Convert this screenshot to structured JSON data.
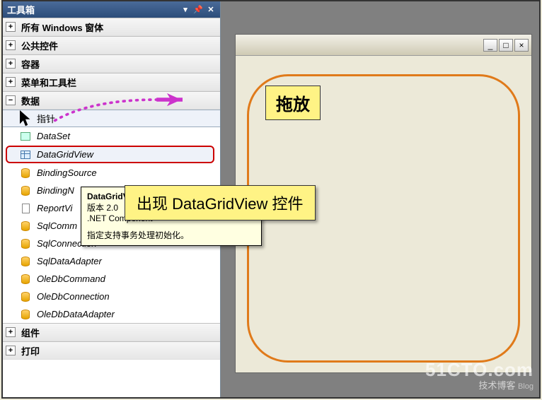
{
  "toolbox": {
    "title": "工具箱",
    "categories": [
      {
        "label": "所有 Windows 窗体",
        "expanded": false
      },
      {
        "label": "公共控件",
        "expanded": false
      },
      {
        "label": "容器",
        "expanded": false
      },
      {
        "label": "菜单和工具栏",
        "expanded": false
      },
      {
        "label": "数据",
        "expanded": true
      },
      {
        "label": "组件",
        "expanded": false
      },
      {
        "label": "打印",
        "expanded": false
      }
    ],
    "data_items": [
      {
        "label": "指针",
        "icon": "cursor",
        "pointer": true,
        "highlight": true
      },
      {
        "label": "DataSet",
        "icon": "box"
      },
      {
        "label": "DataGridView",
        "icon": "grid",
        "selected": true
      },
      {
        "label": "BindingSource",
        "icon": "cyl"
      },
      {
        "label": "BindingNavigator",
        "icon": "cyl",
        "truncated": "BindingN"
      },
      {
        "label": "ReportViewer",
        "icon": "doc",
        "truncated": "ReportVi"
      },
      {
        "label": "SqlCommand",
        "icon": "cyl",
        "truncated": "SqlComm"
      },
      {
        "label": "SqlConnection",
        "icon": "cyl"
      },
      {
        "label": "SqlDataAdapter",
        "icon": "cyl"
      },
      {
        "label": "OleDbCommand",
        "icon": "cyl"
      },
      {
        "label": "OleDbConnection",
        "icon": "cyl"
      },
      {
        "label": "OleDbDataAdapter",
        "icon": "cyl"
      }
    ]
  },
  "tooltip": {
    "title": "DataGridView",
    "version_line": "版本 2.0",
    "component_line": ".NET Component",
    "desc": "指定支持事务处理初始化。"
  },
  "callout": {
    "text": "出现 DataGridView 控件"
  },
  "drop": {
    "label": "拖放"
  },
  "form_window": {
    "minimize": "_",
    "maximize": "□",
    "close": "×"
  },
  "watermark": {
    "line1": "51CTO.com",
    "line2": "技术博客",
    "tag": "Blog"
  },
  "colors": {
    "callout_bg": "#fff385",
    "drop_outline": "#e07a1a",
    "selection_border": "#cc0000",
    "arrow": "#cc33cc"
  }
}
